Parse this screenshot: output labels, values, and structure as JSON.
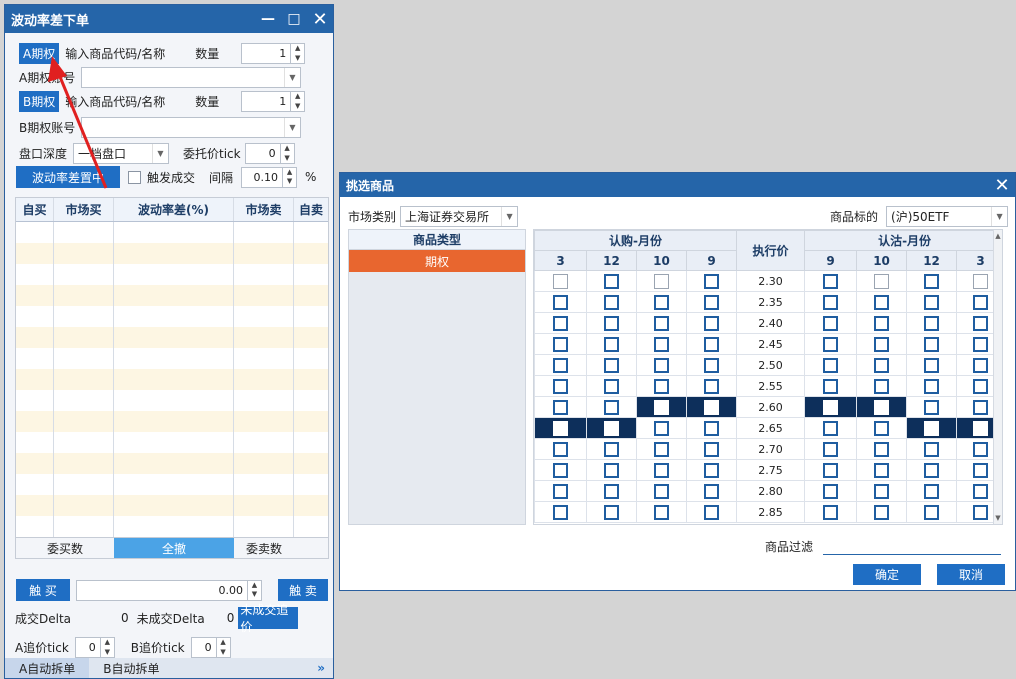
{
  "left_window": {
    "title": "波动率差下单",
    "controls": {
      "minimize": "—",
      "maximize": "□",
      "close": "✕"
    },
    "a_option_button": "A期权",
    "a_input_placeholder": "输入商品代码/名称",
    "a_qty_label": "数量",
    "a_qty_value": "1",
    "a_account_label": "A期权账号",
    "b_option_button": "B期权",
    "b_input_placeholder": "输入商品代码/名称",
    "b_qty_label": "数量",
    "b_qty_value": "1",
    "b_account_label": "B期权账号",
    "depth_label": "盘口深度",
    "depth_value": "一档盘口",
    "tick_label": "委托价tick",
    "tick_value": "0",
    "volatility_button": "波动率差置中",
    "trigger_label": "触发成交",
    "interval_label": "间隔",
    "interval_value": "0.10",
    "interval_unit": "%",
    "table_headers": [
      "自买",
      "市场买",
      "波动率差(%)",
      "市场卖",
      "自卖"
    ],
    "table_footer": {
      "left": "委买数",
      "center": "全撤",
      "right": "委卖数"
    },
    "trigger_buy": "触 买",
    "trigger_value": "0.00",
    "trigger_sell": "触 卖",
    "deal_delta_label": "成交Delta",
    "deal_delta_value": "0",
    "undeal_delta_label": "未成交Delta",
    "undeal_delta_value": "0",
    "chase_button": "未成交追价",
    "a_chase_label": "A追价tick",
    "a_chase_value": "0",
    "b_chase_label": "B追价tick",
    "b_chase_value": "0",
    "bottom_tabs": [
      "A自动拆单",
      "B自动拆单"
    ],
    "bottom_tab_more": "»"
  },
  "dialog": {
    "title": "挑选商品",
    "close": "✕",
    "market_label": "市场类别",
    "market_value": "上海证券交易所",
    "underlying_label": "商品标的",
    "underlying_value": "(沪)50ETF",
    "product_type_header": "商品类型",
    "product_type_item": "期权",
    "call_header": "认购-月份",
    "put_header": "认沽-月份",
    "strike_header": "执行价",
    "call_months": [
      "3",
      "12",
      "10",
      "9"
    ],
    "put_months": [
      "9",
      "10",
      "12",
      "3"
    ],
    "strikes": [
      "2.30",
      "2.35",
      "2.40",
      "2.45",
      "2.50",
      "2.55",
      "2.60",
      "2.65",
      "2.70",
      "2.75",
      "2.80",
      "2.85"
    ],
    "filter_label": "商品过滤",
    "ok_button": "确定",
    "cancel_button": "取消"
  },
  "colors": {
    "title_bar": "#2565a9",
    "accent_button": "#1f6ec4",
    "selected_cell": "#0d2f5b",
    "product_item": "#e8662f",
    "annotation_arrow": "#e02020"
  }
}
